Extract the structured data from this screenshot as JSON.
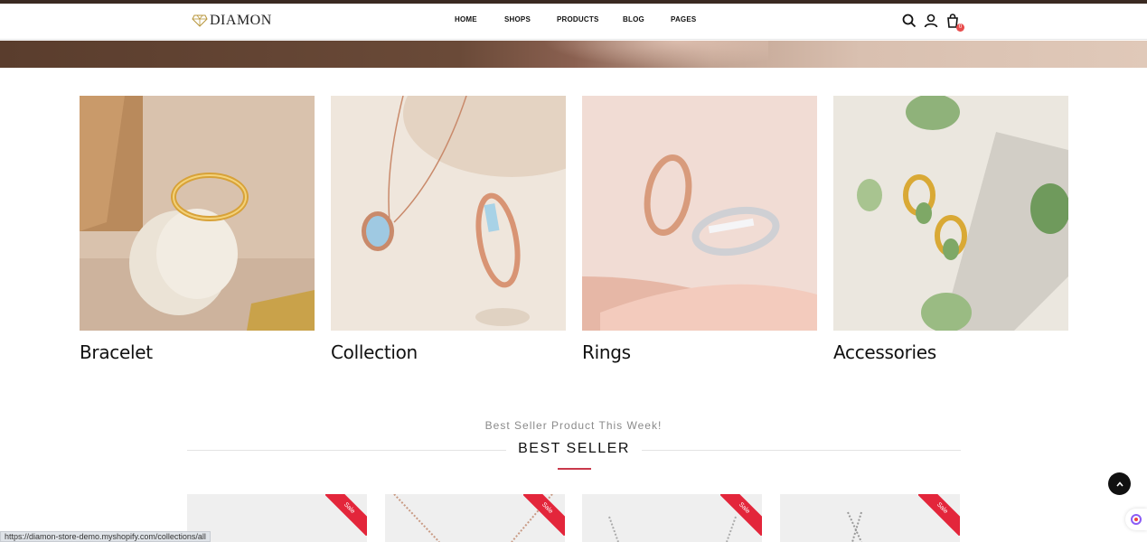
{
  "header": {
    "logo_text": "DIAMON",
    "nav": [
      "HOME",
      "SHOPS",
      "PRODUCTS",
      "BLOG",
      "PAGES"
    ],
    "cart_count": "0"
  },
  "categories": [
    {
      "title": "Bracelet"
    },
    {
      "title": "Collection"
    },
    {
      "title": "Rings"
    },
    {
      "title": "Accessories"
    }
  ],
  "best_seller": {
    "subtitle": "Best Seller Product This Week!",
    "title": "BEST SELLER",
    "badge": "Sale"
  },
  "status_url": "https://diamon-store-demo.myshopify.com/collections/all",
  "colors": {
    "accent": "#c9394b",
    "sale": "#e3263b",
    "dark": "#111111"
  }
}
